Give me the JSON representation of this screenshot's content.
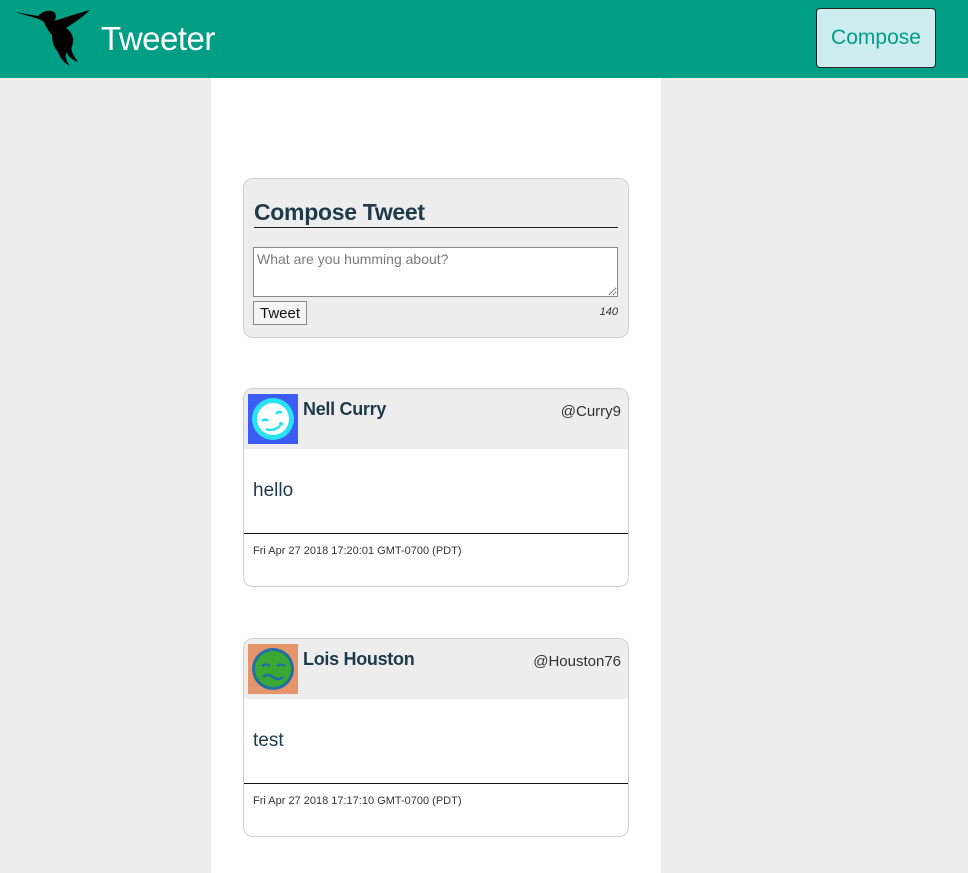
{
  "header": {
    "logo_icon": "hummingbird-icon",
    "app_title": "Tweeter",
    "compose_button_label": "Compose",
    "colors": {
      "bar": "#009e85",
      "compose_button_bg": "#cdecef"
    }
  },
  "compose": {
    "heading": "Compose Tweet",
    "placeholder": "What are you humming about?",
    "value": "",
    "submit_label": "Tweet",
    "char_count": "140"
  },
  "tweets": [
    {
      "name": "Nell Curry",
      "handle": "@Curry9",
      "avatar_icon": "face-avatar-icon",
      "avatar_colors": {
        "bg": "#3d5cf5",
        "face": "#29e2f0"
      },
      "text": "hello",
      "date": "Fri Apr 27 2018 17:20:01 GMT-0700 (PDT)"
    },
    {
      "name": "Lois Houston",
      "handle": "@Houston76",
      "avatar_icon": "face-avatar-icon",
      "avatar_colors": {
        "bg": "#e6946b",
        "face": "#3aa832"
      },
      "text": "test",
      "date": "Fri Apr 27 2018 17:17:10 GMT-0700 (PDT)"
    }
  ]
}
